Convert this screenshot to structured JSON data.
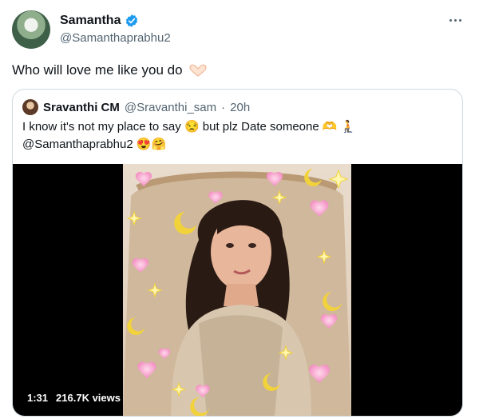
{
  "tweet": {
    "display_name": "Samantha",
    "handle": "@Samanthaprabhu2",
    "text": "Who will love me like you do"
  },
  "quoted_tweet": {
    "display_name": "Sravanthi CM",
    "handle": "@Sravanthi_sam",
    "separator": "·",
    "time": "20h",
    "text_line1": "I know  it's not my place to say 😒 but plz Date someone 🫶 🧎",
    "text_line2": "@Samanthaprabhu2 😍🤗"
  },
  "video": {
    "duration": "1:31",
    "views": "216.7K views"
  },
  "icons": {
    "verified": "verified-badge-icon",
    "more": "more-options-icon",
    "heart_hands": "heart-hands-emoji"
  },
  "colors": {
    "verified_blue": "#1d9bf0",
    "text_primary": "#0f1419",
    "text_secondary": "#536471",
    "border": "#cfd9de"
  }
}
